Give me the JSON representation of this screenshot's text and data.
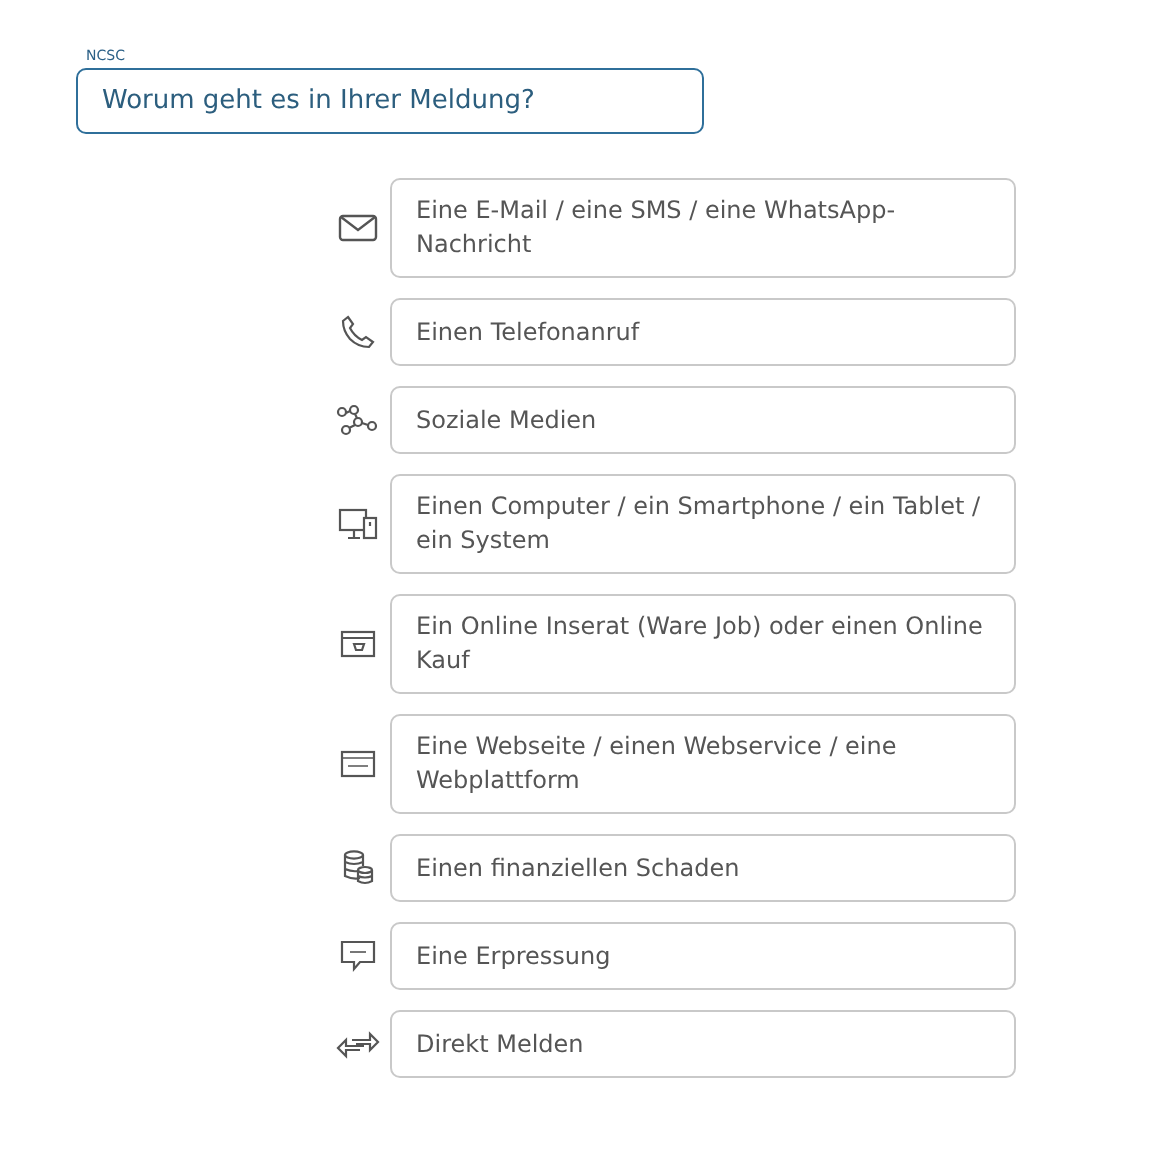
{
  "header": {
    "label": "NCSC"
  },
  "question": "Worum geht es in Ihrer Meldung?",
  "options": [
    {
      "label": "Eine E-Mail / eine SMS / eine WhatsApp-Nachricht"
    },
    {
      "label": "Einen Telefonanruf"
    },
    {
      "label": "Soziale Medien"
    },
    {
      "label": "Einen Computer / ein Smartphone / ein Tablet / ein System"
    },
    {
      "label": "Ein Online Inserat (Ware Job) oder einen Online Kauf"
    },
    {
      "label": "Eine Webseite / einen Webservice / eine Webplattform"
    },
    {
      "label": "Einen finanziellen Schaden"
    },
    {
      "label": "Eine Erpressung"
    },
    {
      "label": "Direkt Melden"
    }
  ]
}
